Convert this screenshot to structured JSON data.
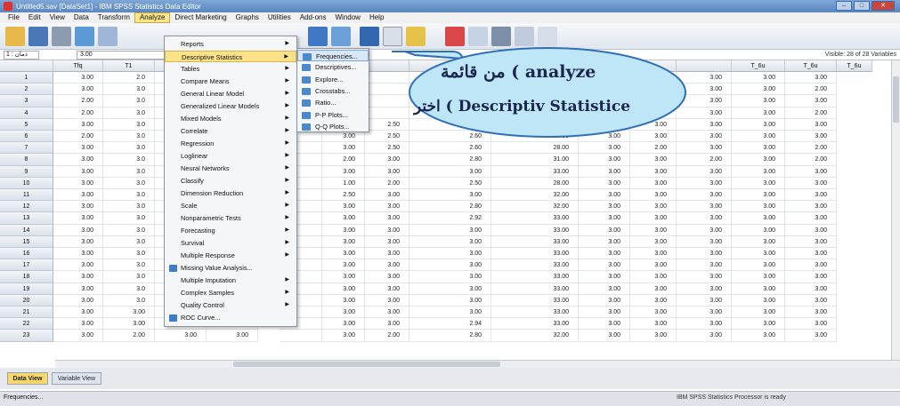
{
  "window": {
    "title": "Untitled5.sav [DataSet1] - IBM SPSS Statistics Data Editor",
    "controls": [
      "–",
      "□",
      "✕"
    ]
  },
  "menubar": [
    "File",
    "Edit",
    "View",
    "Data",
    "Transform",
    "Analyze",
    "Direct Marketing",
    "Graphs",
    "Utilities",
    "Add-ons",
    "Window",
    "Help"
  ],
  "cellbar": {
    "ref": "دمان : 1",
    "value": "3.00",
    "visible": "Visible: 28 of 28 Variables"
  },
  "columns": [
    "",
    "Tfq",
    "T1",
    "",
    "",
    "",
    "",
    "",
    "",
    "",
    "",
    "",
    "",
    "",
    "T_6u",
    "T_6u",
    "T_6u"
  ],
  "rows": [
    [
      "1",
      "3.00",
      "2.0",
      "",
      "",
      "",
      "",
      "",
      "",
      "",
      "",
      "",
      "3.00",
      "3.00",
      "3.00"
    ],
    [
      "2",
      "3.00",
      "3.0",
      "",
      "",
      "",
      "",
      "",
      "",
      "",
      "",
      "",
      "3.00",
      "3.00",
      "2.00"
    ],
    [
      "3",
      "2.00",
      "3.0",
      "",
      "",
      "",
      "",
      "",
      "",
      "",
      "",
      "",
      "3.00",
      "3.00",
      "3.00"
    ],
    [
      "4",
      "2.00",
      "3.0",
      "",
      "",
      "",
      "",
      "",
      "",
      "",
      "",
      "",
      "3.00",
      "3.00",
      "2.00"
    ],
    [
      "5",
      "3.00",
      "3.0",
      "",
      "",
      "",
      "2.00",
      "2.50",
      "2.80",
      "34.00",
      "2.00",
      "3.00",
      "3.00",
      "3.00",
      "3.00"
    ],
    [
      "6",
      "2.00",
      "3.0",
      "",
      "",
      "",
      "3.00",
      "2.50",
      "2.60",
      "29.00",
      "3.00",
      "3.00",
      "3.00",
      "3.00",
      "3.00"
    ],
    [
      "7",
      "3.00",
      "3.0",
      "",
      "",
      "",
      "3.00",
      "2.50",
      "2.60",
      "28.00",
      "3.00",
      "2.00",
      "3.00",
      "3.00",
      "2.00"
    ],
    [
      "8",
      "3.00",
      "3.0",
      "",
      "",
      "",
      "2.00",
      "3.00",
      "2.80",
      "31.00",
      "3.00",
      "3.00",
      "2.00",
      "3.00",
      "2.00"
    ],
    [
      "9",
      "3.00",
      "3.0",
      "",
      "",
      "",
      "3.00",
      "3.00",
      "3.00",
      "33.00",
      "3.00",
      "3.00",
      "3.00",
      "3.00",
      "3.00"
    ],
    [
      "10",
      "3.00",
      "3.0",
      "",
      "",
      "",
      "1.00",
      "2.00",
      "2.50",
      "28.00",
      "3.00",
      "3.00",
      "3.00",
      "3.00",
      "3.00"
    ],
    [
      "11",
      "3.00",
      "3.0",
      "",
      "",
      "",
      "2.50",
      "3.00",
      "3.00",
      "32.00",
      "3.00",
      "3.00",
      "3.00",
      "3.00",
      "3.00"
    ],
    [
      "12",
      "3.00",
      "3.0",
      "",
      "",
      "",
      "3.00",
      "3.00",
      "2.80",
      "32.00",
      "3.00",
      "3.00",
      "3.00",
      "3.00",
      "3.00"
    ],
    [
      "13",
      "3.00",
      "3.0",
      "",
      "",
      "",
      "3.00",
      "3.00",
      "2.92",
      "33.00",
      "3.00",
      "3.00",
      "3.00",
      "3.00",
      "3.00"
    ],
    [
      "14",
      "3.00",
      "3.0",
      "",
      "",
      "",
      "3.00",
      "3.00",
      "3.00",
      "33.00",
      "3.00",
      "3.00",
      "3.00",
      "3.00",
      "3.00"
    ],
    [
      "15",
      "3.00",
      "3.0",
      "",
      "",
      "",
      "3.00",
      "3.00",
      "3.00",
      "33.00",
      "3.00",
      "3.00",
      "3.00",
      "3.00",
      "3.00"
    ],
    [
      "16",
      "3.00",
      "3.0",
      "",
      "",
      "",
      "3.00",
      "3.00",
      "3.00",
      "33.00",
      "3.00",
      "3.00",
      "3.00",
      "3.00",
      "3.00"
    ],
    [
      "17",
      "3.00",
      "3.0",
      "",
      "",
      "",
      "3.00",
      "3.00",
      "3.00",
      "33.00",
      "3.00",
      "3.00",
      "3.00",
      "3.00",
      "3.00"
    ],
    [
      "18",
      "3.00",
      "3.0",
      "",
      "",
      "",
      "3.00",
      "3.00",
      "3.00",
      "33.00",
      "3.00",
      "3.00",
      "3.00",
      "3.00",
      "3.00"
    ],
    [
      "19",
      "3.00",
      "3.0",
      "",
      "",
      "",
      "3.00",
      "3.00",
      "3.00",
      "33.00",
      "3.00",
      "3.00",
      "3.00",
      "3.00",
      "3.00"
    ],
    [
      "20",
      "3.00",
      "3.0",
      "",
      "",
      "",
      "3.00",
      "3.00",
      "3.00",
      "33.00",
      "3.00",
      "3.00",
      "3.00",
      "3.00",
      "3.00"
    ],
    [
      "21",
      "3.00",
      "3.00",
      "3.00",
      "3.00",
      "",
      "3.00",
      "3.00",
      "3.00",
      "33.00",
      "3.00",
      "3.00",
      "3.00",
      "3.00",
      "3.00"
    ],
    [
      "22",
      "3.00",
      "3.00",
      "3.00",
      "2.75",
      "",
      "3.00",
      "3.00",
      "2.94",
      "33.00",
      "3.00",
      "3.00",
      "3.00",
      "3.00",
      "3.00"
    ],
    [
      "23",
      "3.00",
      "2.00",
      "3.00",
      "3.00",
      "",
      "3.00",
      "2.00",
      "2.80",
      "32.00",
      "3.00",
      "3.00",
      "3.00",
      "3.00",
      "3.00"
    ]
  ],
  "analyze_menu": [
    {
      "label": "Reports",
      "sub": true
    },
    {
      "label": "Descriptive Statistics",
      "sub": true,
      "hl": true
    },
    {
      "label": "Tables",
      "sub": true
    },
    {
      "label": "Compare Means",
      "sub": true
    },
    {
      "label": "General Linear Model",
      "sub": true
    },
    {
      "label": "Generalized Linear Models",
      "sub": true
    },
    {
      "label": "Mixed Models",
      "sub": true
    },
    {
      "label": "Correlate",
      "sub": true
    },
    {
      "label": "Regression",
      "sub": true
    },
    {
      "label": "Loglinear",
      "sub": true
    },
    {
      "label": "Neural Networks",
      "sub": true
    },
    {
      "label": "Classify",
      "sub": true
    },
    {
      "label": "Dimension Reduction",
      "sub": true
    },
    {
      "label": "Scale",
      "sub": true
    },
    {
      "label": "Nonparametric Tests",
      "sub": true
    },
    {
      "label": "Forecasting",
      "sub": true
    },
    {
      "label": "Survival",
      "sub": true
    },
    {
      "label": "Multiple Response",
      "sub": true
    },
    {
      "label": "Missing Value Analysis...",
      "sub": false,
      "icon": true
    },
    {
      "label": "Multiple Imputation",
      "sub": true
    },
    {
      "label": "Complex Samples",
      "sub": true
    },
    {
      "label": "Quality Control",
      "sub": true
    },
    {
      "label": "ROC Curve...",
      "sub": false,
      "icon": true
    }
  ],
  "desc_submenu": [
    "Frequencies...",
    "Descriptives...",
    "Explore...",
    "Crosstabs...",
    "Ratio...",
    "P-P Plots...",
    "Q-Q Plots..."
  ],
  "callout": {
    "line1": "من قائمة ( analyze",
    "line2": "اختر ( Descriptiv Statistice"
  },
  "tabs": {
    "data_view": "Data View",
    "variable_view": "Variable View"
  },
  "status": {
    "left": "Frequencies...",
    "right": "IBM SPSS Statistics Processor is ready"
  },
  "colors": {
    "menu_highlight": "#fde28a",
    "callout_fill": "#bfe6f7",
    "callout_stroke": "#2f6fb8",
    "tab_active": "#f6d86a"
  }
}
